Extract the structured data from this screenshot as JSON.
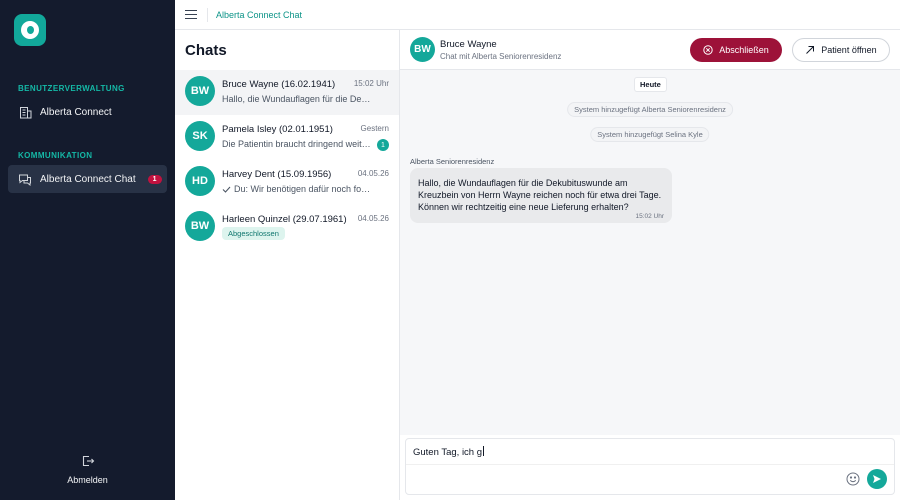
{
  "sidebar": {
    "sections": [
      {
        "label": "BENUTZERVERWALTUNG",
        "items": [
          {
            "label": "Alberta Connect"
          }
        ]
      },
      {
        "label": "KOMMUNIKATION",
        "items": [
          {
            "label": "Alberta Connect Chat",
            "badge": "1"
          }
        ]
      }
    ],
    "logout_label": "Abmelden"
  },
  "topbar": {
    "breadcrumb": "Alberta Connect Chat"
  },
  "chatlist": {
    "title": "Chats",
    "items": [
      {
        "initials": "BW",
        "name": "Bruce Wayne (16.02.1941)",
        "time": "15:02 Uhr",
        "preview": "Hallo, die Wundauflagen für die Dekubituswunde am Kreuzbein"
      },
      {
        "initials": "SK",
        "name": "Pamela Isley (02.01.1951)",
        "time": "Gestern",
        "preview": "Die Patientin braucht dringend weitere Verbandsmittel",
        "unread": "1"
      },
      {
        "initials": "HD",
        "name": "Harvey Dent (15.09.1956)",
        "time": "04.05.26",
        "preview": "Du: Wir benötigen dafür noch folgende Unterlagen"
      },
      {
        "initials": "BW",
        "name": "Harleen Quinzel (29.07.1961)",
        "time": "04.05.26",
        "tag": "Abgeschlossen"
      }
    ]
  },
  "conversation": {
    "initials": "BW",
    "name": "Bruce Wayne",
    "subtitle": "Chat mit Alberta Seniorenresidenz",
    "close_button": "Abschließen",
    "open_patient_button": "Patient öffnen",
    "date_chip": "Heute",
    "system_messages": [
      "System hinzugefügt Alberta Seniorenresidenz",
      "System hinzugefügt Selina Kyle"
    ],
    "message": {
      "sender": "Alberta Seniorenresidenz",
      "text": "Hallo, die Wundauflagen für die Dekubituswunde am Kreuzbein von Herrn Wayne reichen noch für etwa drei Tage. Können wir rechtzeitig eine neue Lieferung erhalten?",
      "time": "15:02 Uhr"
    },
    "composer": {
      "value": "Guten Tag, ich g"
    }
  },
  "colors": {
    "sidebar_bg": "#141b2d",
    "accent_teal": "#14a89a",
    "danger_button": "#9d1239",
    "badge_red": "#c0123f"
  },
  "icons": [
    "logo-icon",
    "building-icon",
    "chat-bubbles-icon",
    "logout-icon",
    "hamburger-icon",
    "close-circle-icon",
    "arrow-up-right-icon",
    "check-icon",
    "emoji-icon",
    "send-icon"
  ]
}
